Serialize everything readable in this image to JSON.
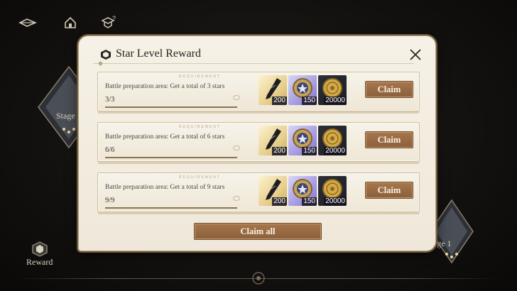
{
  "nav": {
    "icons": [
      "back-arrow-icon",
      "home-icon",
      "help-icon"
    ]
  },
  "background": {
    "stage_left_label": "Stage",
    "stage_right_label": "age 1",
    "reward_label": "Reward"
  },
  "dialog": {
    "title": "Star Level Reward",
    "requirement_tag": "REQUIREMENT",
    "tasks": [
      {
        "description": "Battle preparation area: Get a total of 3 stars",
        "progress": "3/3",
        "progress_fraction": 1.0,
        "rewards": [
          {
            "icon": "feather-quill-icon",
            "qty": "200"
          },
          {
            "icon": "star-medal-icon",
            "qty": "150"
          },
          {
            "icon": "gold-coin-icon",
            "qty": "20000"
          }
        ],
        "claim_label": "Claim"
      },
      {
        "description": "Battle preparation area: Get a total of 6 stars",
        "progress": "6/6",
        "progress_fraction": 1.0,
        "rewards": [
          {
            "icon": "feather-quill-icon",
            "qty": "200"
          },
          {
            "icon": "star-medal-icon",
            "qty": "150"
          },
          {
            "icon": "gold-coin-icon",
            "qty": "20000"
          }
        ],
        "claim_label": "Claim"
      },
      {
        "description": "Battle preparation area: Get a total of 9 stars",
        "progress": "9/9",
        "progress_fraction": 1.0,
        "rewards": [
          {
            "icon": "feather-quill-icon",
            "qty": "200"
          },
          {
            "icon": "star-medal-icon",
            "qty": "150"
          },
          {
            "icon": "gold-coin-icon",
            "qty": "20000"
          }
        ],
        "claim_label": "Claim"
      }
    ],
    "claim_all_label": "Claim all"
  },
  "colors": {
    "button_brown": "#9a6b44",
    "panel_cream": "#f3ede1",
    "gold_rarity": "#e7cf8d",
    "purple_rarity": "#a59be2",
    "dark_rarity": "#1f2028"
  }
}
